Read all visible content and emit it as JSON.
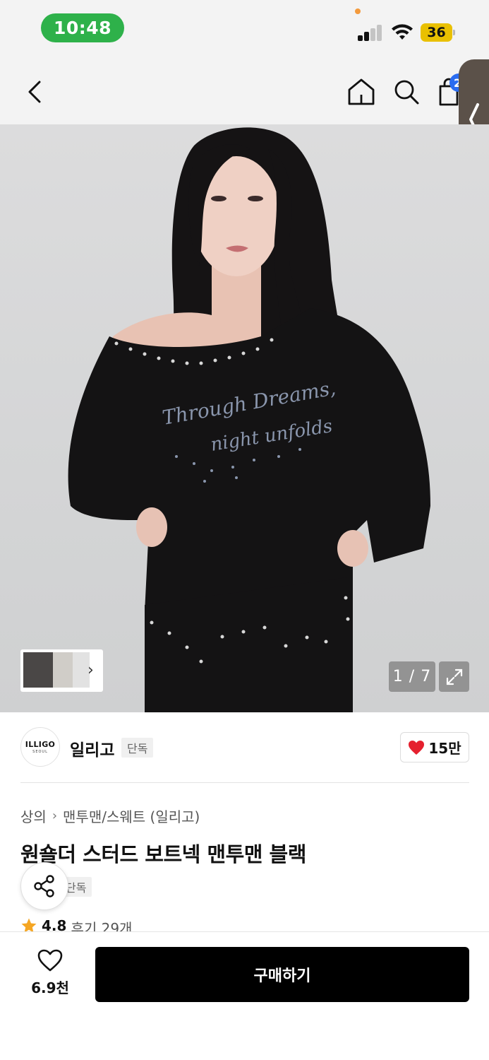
{
  "status_bar": {
    "time": "10:48",
    "battery": "36",
    "time_pill_color": "#2eb14a",
    "battery_color": "#e9c000"
  },
  "nav": {
    "cart_count": "2",
    "icons": [
      "back-icon",
      "home-icon",
      "search-icon",
      "cart-icon"
    ]
  },
  "gallery": {
    "counter": "1 / 7",
    "shirt_text_line1": "Through Dreams,",
    "shirt_text_line2": "night unfolds"
  },
  "brand": {
    "logo_text": "ILLIGO",
    "logo_sub": "SEOUL",
    "name": "일리고",
    "tag": "단독",
    "likes": "15만"
  },
  "product": {
    "breadcrumb": [
      "상의",
      "맨투맨/스웨트 (일리고)"
    ],
    "title": "원숄더 스터드 보트넥 맨투맨 블랙",
    "exclusive_tag": "단독",
    "rating": "4.8",
    "reviews": "후기 29개"
  },
  "bottom_bar": {
    "wish_count": "6.9천",
    "buy_label": "구매하기"
  },
  "colors": {
    "heart": "#e5202e",
    "star": "#f5a623",
    "accent_badge": "#2a6cf0"
  }
}
